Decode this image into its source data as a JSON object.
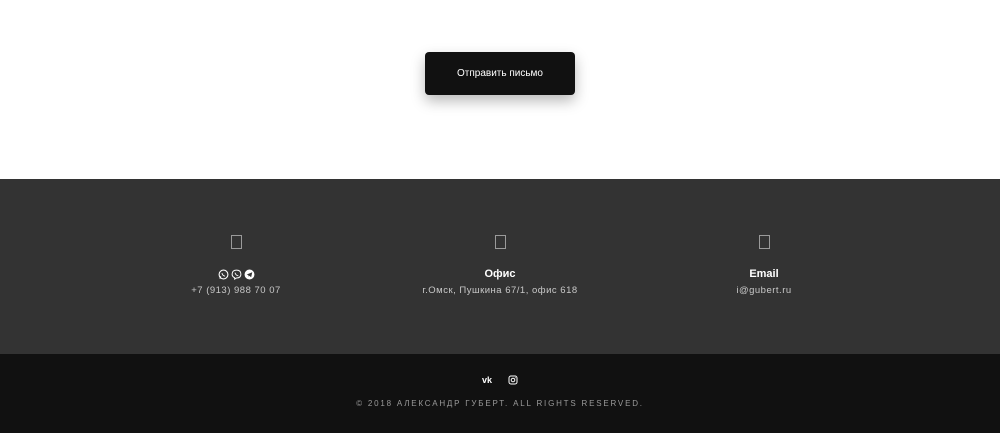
{
  "cta": {
    "label": "Отправить письмо"
  },
  "contacts": [
    {
      "icon": "phone-icon",
      "title": "",
      "messengers": [
        "whatsapp-icon",
        "viber-icon",
        "telegram-icon"
      ],
      "value": "+7 (913) 988 70 07"
    },
    {
      "icon": "map-marker-icon",
      "title": "Офис",
      "value": "г.Омск, Пушкина 67/1, офис 618"
    },
    {
      "icon": "envelope-icon",
      "title": "Email",
      "value": "i@gubert.ru"
    }
  ],
  "footer": {
    "socials": [
      {
        "icon": "vk-icon",
        "label": "vk"
      },
      {
        "icon": "instagram-icon"
      }
    ],
    "copyright": "© 2018 АЛЕКСАНДР ГУБЕРТ. ALL RIGHTS RESERVED."
  },
  "colors": {
    "contacts_bg": "#333333",
    "footer_bg": "#111111",
    "button_bg": "#111111"
  }
}
